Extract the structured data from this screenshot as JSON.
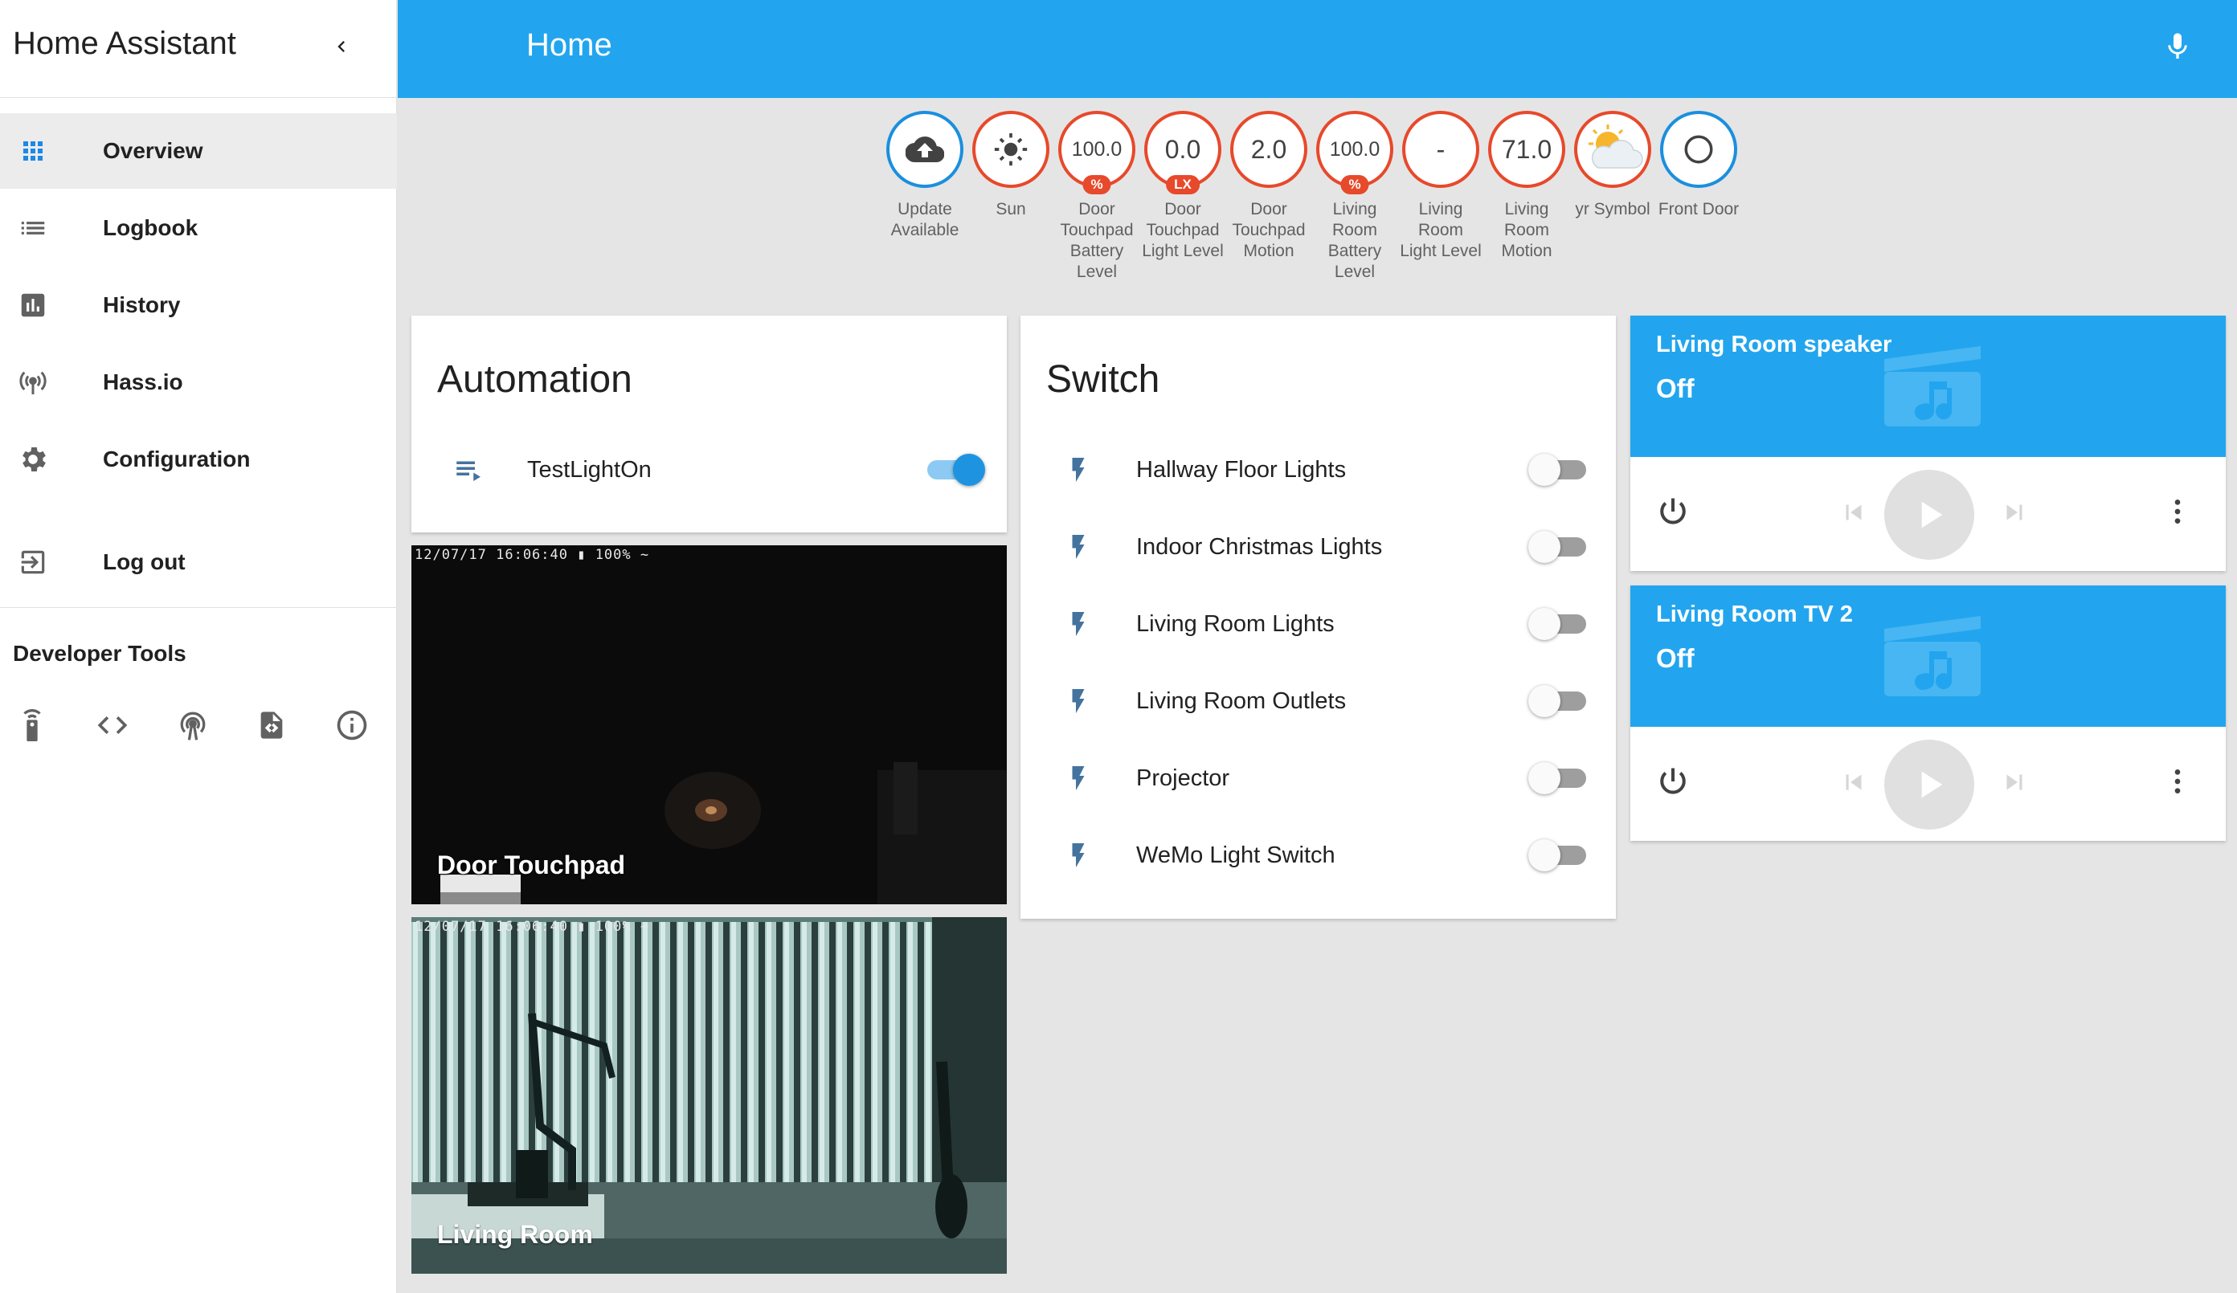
{
  "app": {
    "title": "Home Assistant"
  },
  "sidebar": {
    "items": [
      {
        "label": "Overview",
        "icon": "apps-grid-icon"
      },
      {
        "label": "Logbook",
        "icon": "list-icon"
      },
      {
        "label": "History",
        "icon": "chart-bar-icon"
      },
      {
        "label": "Hass.io",
        "icon": "broadcast-icon"
      },
      {
        "label": "Configuration",
        "icon": "gear-icon"
      },
      {
        "label": "Log out",
        "icon": "exit-icon"
      }
    ],
    "developer_tools_title": "Developer Tools",
    "developer_tools": [
      "remote-icon",
      "code-tags-icon",
      "broadcast-tower-icon",
      "file-code-icon",
      "info-icon"
    ]
  },
  "header": {
    "title": "Home",
    "accent_color": "#22a5ee"
  },
  "badges": [
    {
      "value": "",
      "unit": "",
      "label": "Update Available",
      "icon": "cloud-upload-icon",
      "color": "#1a8fde"
    },
    {
      "value": "",
      "unit": "",
      "label": "Sun",
      "icon": "sun-icon",
      "color": "#e7492b"
    },
    {
      "value": "100.0",
      "unit": "%",
      "label": "Door Touchpad Battery Level",
      "color": "#e7492b"
    },
    {
      "value": "0.0",
      "unit": "LX",
      "label": "Door Touchpad Light Level",
      "color": "#e7492b"
    },
    {
      "value": "2.0",
      "unit": "",
      "label": "Door Touchpad Motion",
      "color": "#e7492b"
    },
    {
      "value": "100.0",
      "unit": "%",
      "label": "Living Room Battery Level",
      "color": "#e7492b"
    },
    {
      "value": "-",
      "unit": "",
      "label": "Living Room Light Level",
      "color": "#e7492b"
    },
    {
      "value": "71.0",
      "unit": "",
      "label": "Living Room Motion",
      "color": "#e7492b"
    },
    {
      "value": "",
      "unit": "",
      "label": "yr Symbol",
      "icon": "partly-cloudy-icon",
      "color": "#e7492b"
    },
    {
      "value": "",
      "unit": "",
      "label": "Front Door",
      "icon": "circle-outline-icon",
      "color": "#1a8fde"
    }
  ],
  "automation": {
    "title": "Automation",
    "items": [
      {
        "label": "TestLightOn",
        "on": true
      }
    ]
  },
  "cameras": [
    {
      "label": "Door Touchpad",
      "timestamp": "12/07/17 16:06:40 ▮ 100% ~"
    },
    {
      "label": "Living Room",
      "timestamp": "12/07/17 16:06:40 ▮ 100% ~"
    }
  ],
  "switch": {
    "title": "Switch",
    "items": [
      {
        "label": "Hallway Floor Lights",
        "on": false
      },
      {
        "label": "Indoor Christmas Lights",
        "on": false
      },
      {
        "label": "Living Room Lights",
        "on": false
      },
      {
        "label": "Living Room Outlets",
        "on": false
      },
      {
        "label": "Projector",
        "on": false
      },
      {
        "label": "WeMo Light Switch",
        "on": false
      }
    ]
  },
  "media_players": [
    {
      "name": "Living Room speaker",
      "state": "Off"
    },
    {
      "name": "Living Room TV 2",
      "state": "Off"
    }
  ]
}
